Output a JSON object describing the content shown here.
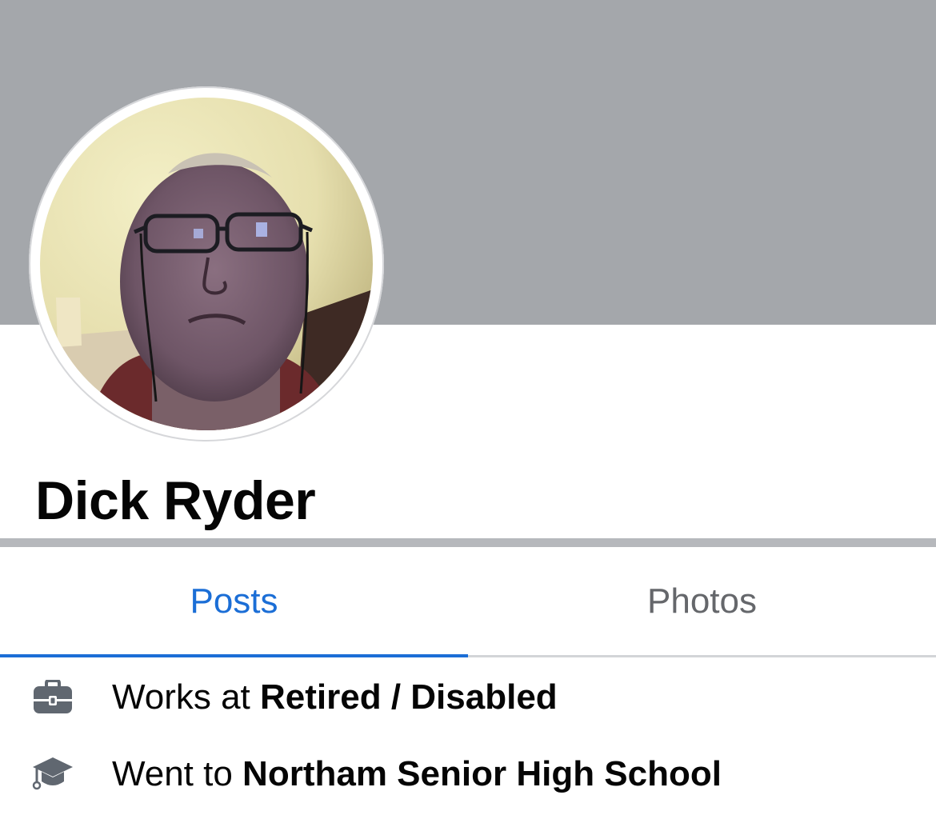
{
  "profile": {
    "name": "Dick Ryder"
  },
  "tabs": [
    {
      "label": "Posts",
      "active": true
    },
    {
      "label": "Photos",
      "active": false
    }
  ],
  "intro": {
    "work": {
      "icon": "briefcase-icon",
      "prefix": "Works at ",
      "value": "Retired / Disabled"
    },
    "education": {
      "icon": "graduation-cap-icon",
      "prefix": "Went to ",
      "value": "Northam Senior High School"
    }
  },
  "colors": {
    "cover": "#a4a7ab",
    "active_tab": "#1b6ed6",
    "inactive_tab": "#65676b",
    "icon": "#606770"
  }
}
